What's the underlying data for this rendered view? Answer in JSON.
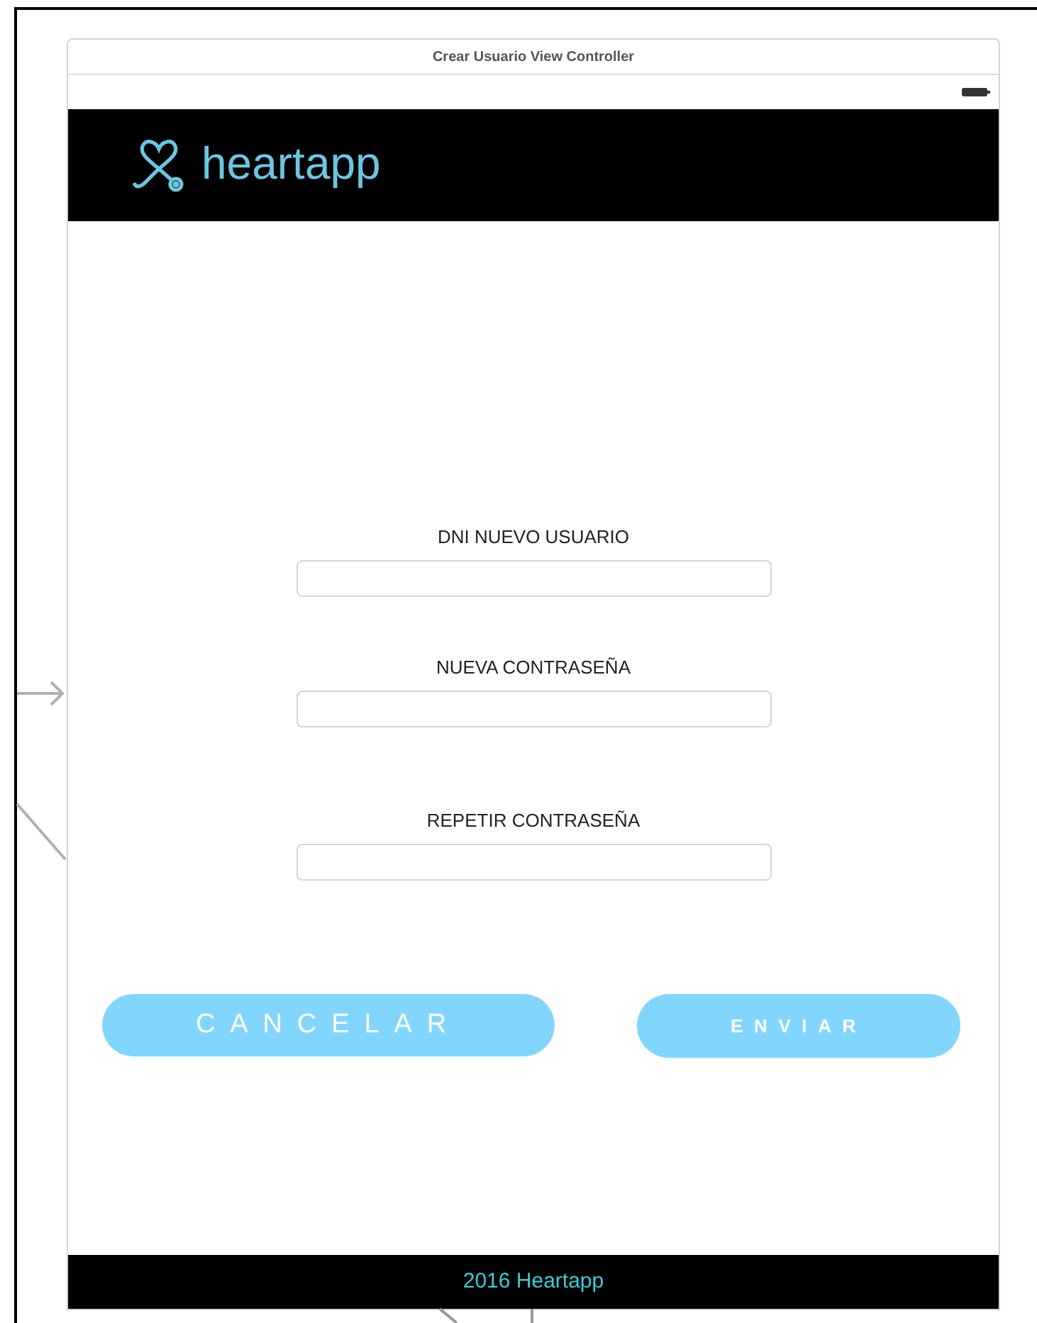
{
  "window": {
    "title": "Crear Usuario View Controller"
  },
  "header": {
    "logo_text": "heartapp"
  },
  "fields": [
    {
      "label": "DNI NUEVO USUARIO"
    },
    {
      "label": "NUEVA CONTRASEÑA"
    },
    {
      "label": "REPETIR CONTRASEÑA"
    }
  ],
  "buttons": [
    {
      "label": "CANCELAR",
      "kind": "light"
    },
    {
      "label": "ENVIAR",
      "kind": "bold"
    }
  ],
  "footer": {
    "text": "2016 Heartapp"
  }
}
